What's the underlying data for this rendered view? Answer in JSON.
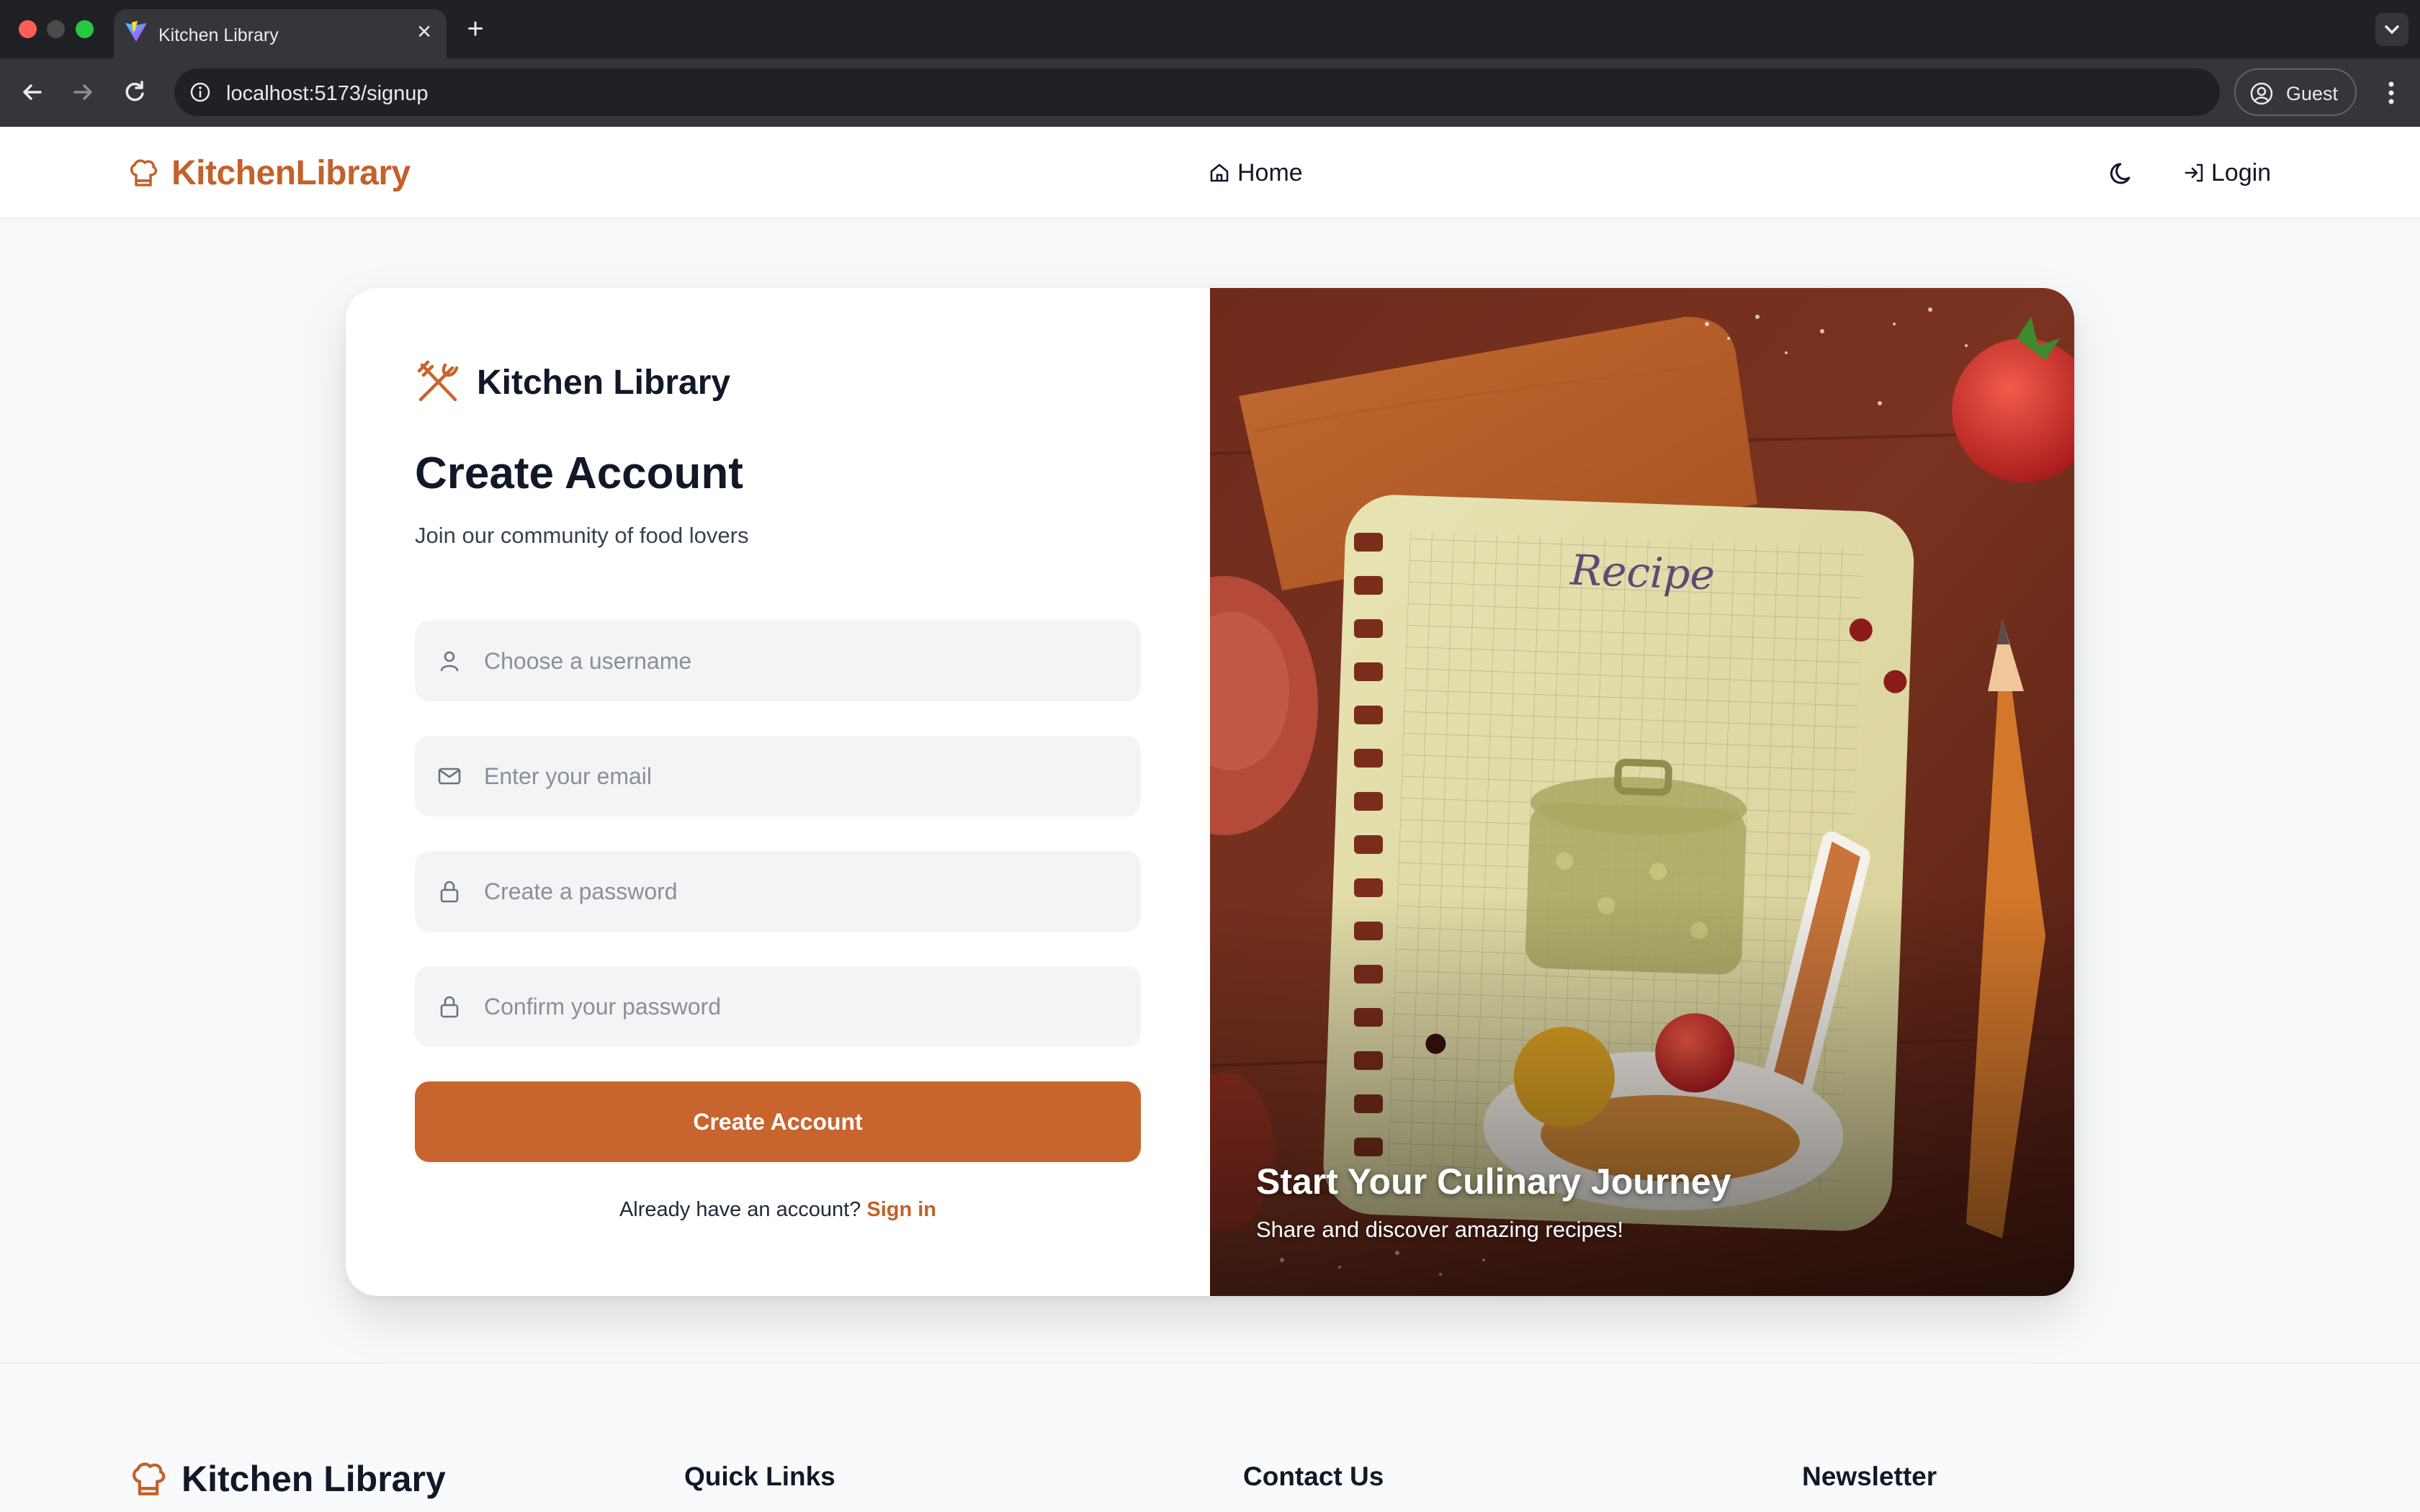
{
  "browser": {
    "tab_title": "Kitchen Library",
    "url": "localhost:5173/signup",
    "profile_label": "Guest"
  },
  "header": {
    "brand": "KitchenLibrary",
    "nav_home": "Home",
    "login": "Login"
  },
  "signup": {
    "brand": "Kitchen Library",
    "title": "Create Account",
    "subtitle": "Join our community of food lovers",
    "fields": [
      {
        "icon": "user-icon",
        "placeholder": "Choose a username",
        "value": ""
      },
      {
        "icon": "mail-icon",
        "placeholder": "Enter your email",
        "value": ""
      },
      {
        "icon": "lock-icon",
        "placeholder": "Create a password",
        "value": ""
      },
      {
        "icon": "lock-icon",
        "placeholder": "Confirm your password",
        "value": ""
      }
    ],
    "submit": "Create Account",
    "signin_prompt": "Already have an account?",
    "signin_link": "Sign in"
  },
  "hero": {
    "recipe_word": "Recipe",
    "title": "Start Your Culinary Journey",
    "subtitle": "Share and discover amazing recipes!"
  },
  "footer": {
    "brand": "Kitchen Library",
    "quick_links": "Quick Links",
    "contact": "Contact Us",
    "newsletter": "Newsletter"
  },
  "colors": {
    "accent": "#c8642d",
    "brand": "#c2612a",
    "text": "#111827"
  }
}
